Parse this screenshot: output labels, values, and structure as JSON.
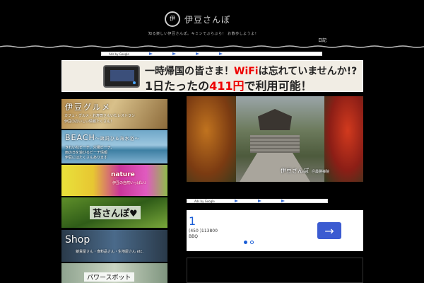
{
  "header": {
    "logo_glyph": "伊",
    "site_title": "伊豆さんぽ",
    "tagline": "知る楽しい伊豆さんぽ。キミンでぶらぶら！ お散歩しようよ！",
    "diary_link": "日記"
  },
  "ads_label": "Ads by Google",
  "banner_ad": {
    "line1_prefix": "一時帰国の皆さま！",
    "line1_highlight": "WiFi",
    "line1_suffix": "は忘れていませんか!?",
    "line2_prefix": "1日たったの",
    "line2_highlight": "411円",
    "line2_suffix": "で利用可能！"
  },
  "nav": {
    "gourmet": {
      "title": "伊豆グルメ",
      "sub1": "カフェ・グルメ・お寿司さんいたレストラン",
      "sub2": "伊豆のおいしい情報たくさん！"
    },
    "beach": {
      "title": "BEACH",
      "title_suffix": "～諸説ひ＆海水浴～",
      "sub1": "きれいなビーチ、穴場ビーチ、",
      "sub2": "雨の日を遊びるビーチ情報",
      "sub3": "伊豆にはたくさんあります"
    },
    "nature": {
      "title": "nature",
      "sub": "伊豆の自然いっぱい♪"
    },
    "koke": {
      "title": "苔さんぽ♥"
    },
    "shop": {
      "title": "Shop",
      "sub": "雑貨屋さん・食料品さん・生地屋さん etc."
    },
    "power": {
      "title": "パワースポット"
    }
  },
  "hero": {
    "caption": "伊豆さんぽ",
    "caption_sub": "＠最勝禅院"
  },
  "side_ad": {
    "number": "1",
    "phone": "(450 )113800",
    "name": "BBQ",
    "arrow": "→"
  },
  "colors": {
    "background": "#000000",
    "ad_accent": "#1a5dd6",
    "banner_highlight": "#e00000"
  },
  "icons": [
    "logo-icon",
    "arrow-right-icon",
    "adchoices-icon"
  ]
}
